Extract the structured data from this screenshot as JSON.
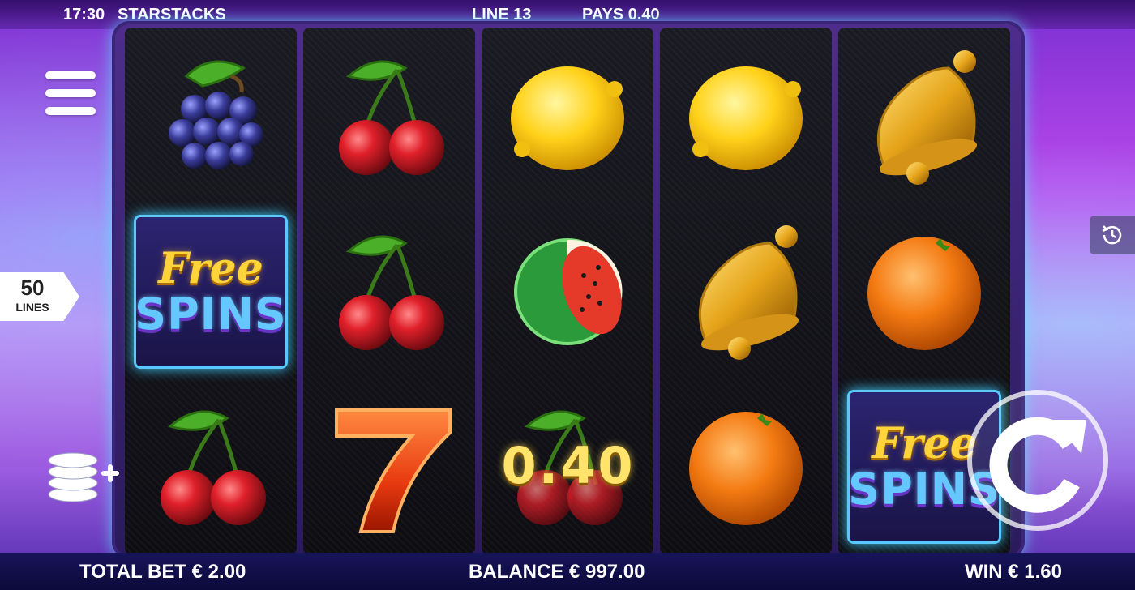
{
  "header": {
    "clock": "17:30",
    "game_name": "STARSTACKS",
    "line_info": "LINE 13",
    "pays_info": "PAYS 0.40"
  },
  "footer": {
    "total_bet": "TOTAL BET € 2.00",
    "balance": "BALANCE € 997.00",
    "win": "WIN € 1.60"
  },
  "lines_badge": {
    "count": "50",
    "label": "LINES"
  },
  "free_spins_symbol": {
    "line1": "Free",
    "line2": "SPINS"
  },
  "win_overlay": "0.40",
  "reels": [
    [
      "grapes",
      "free-spins",
      "cherry"
    ],
    [
      "cherry",
      "cherry",
      "seven"
    ],
    [
      "lemon",
      "watermelon",
      "cherry"
    ],
    [
      "lemon",
      "bell",
      "orange"
    ],
    [
      "bell",
      "orange",
      "free-spins"
    ]
  ],
  "icons": {
    "menu": "menu-icon",
    "coins": "coins-add-icon",
    "history": "history-icon",
    "spin": "spin-icon"
  },
  "colors": {
    "accent_cyan": "#5ac8ff",
    "gold": "#ffd43b",
    "bar_dark": "#17145a"
  }
}
